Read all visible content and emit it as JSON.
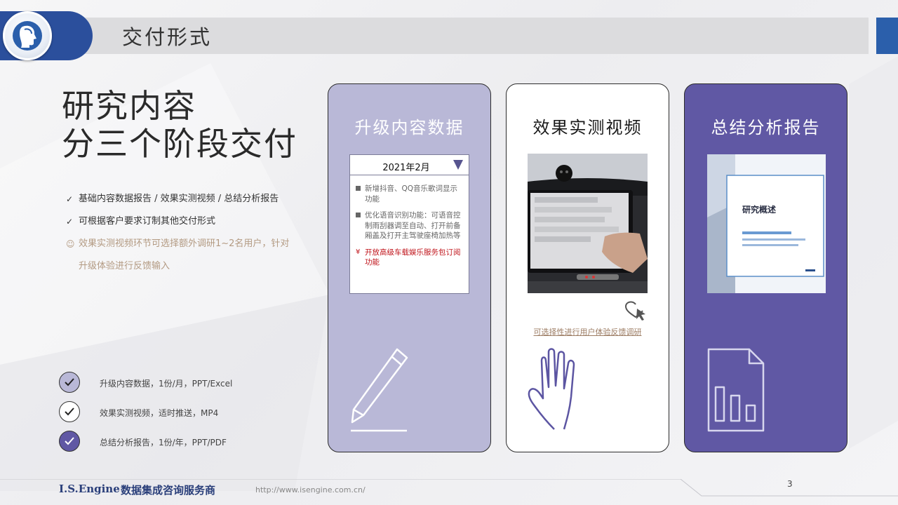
{
  "header": {
    "title": "交付形式"
  },
  "main": {
    "title_line1": "研究内容",
    "title_line2": "分三个阶段交付",
    "bullets": [
      {
        "mark": "✓",
        "text": "基础内容数据报告 / 效果实测视频 / 总结分析报告"
      },
      {
        "mark": "✓",
        "text": "可根据客户要求订制其他交付形式"
      }
    ],
    "note": {
      "mark": "☺",
      "line1": "效果实测视频环节可选择额外调研1~2名用户，针对",
      "line2": "升级体验进行反馈输入"
    }
  },
  "legend": [
    {
      "text": "升级内容数据，1份/月，PPT/Excel",
      "fill": "#b9b8d7"
    },
    {
      "text": "效果实测视频，适时推送，MP4",
      "fill": "#ffffff"
    },
    {
      "text": "总结分析报告，1份/年，PPT/PDF",
      "fill": "#6058a4"
    }
  ],
  "cards": {
    "data": {
      "title": "升级内容数据",
      "panel_date": "2021年2月",
      "items": [
        "新增抖音、QQ音乐歌词显示功能",
        "优化语音识别功能：可语音控制雨刮器调至自动、打开前备厢盖及打开主驾驶座椅加热等"
      ],
      "highlight_mark": "¥",
      "highlight": "开放高级车载娱乐服务包订阅功能"
    },
    "video": {
      "title": "效果实测视频",
      "link": "可选择性进行用户体验反馈调研"
    },
    "report": {
      "title": "总结分析报告",
      "doc_heading": "研究概述"
    }
  },
  "footer": {
    "brand": "I.S.Engine",
    "tagline": "数据集成咨询服务商",
    "url": "http://www.isengine.com.cn/",
    "page": "3"
  }
}
